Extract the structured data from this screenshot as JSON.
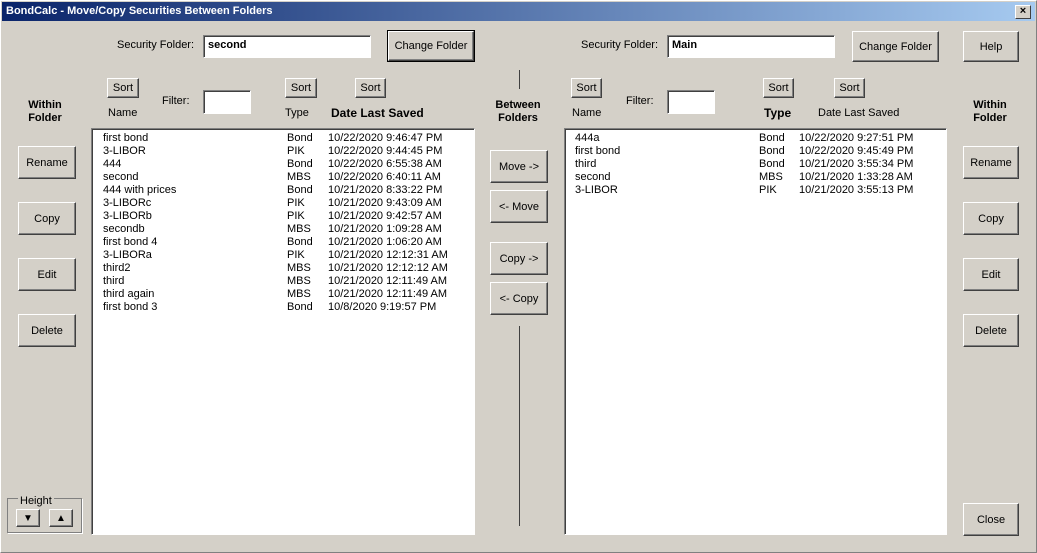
{
  "window": {
    "title": "BondCalc - Move/Copy Securities Between Folders",
    "close_label": "×"
  },
  "left": {
    "folder_label": "Security Folder:",
    "folder_value": "second",
    "change_folder": "Change Folder",
    "sort": "Sort",
    "name_header": "Name",
    "filter_label": "Filter:",
    "filter_value": "",
    "type_header": "Type",
    "date_header": "Date Last Saved",
    "rows": [
      {
        "name": "first bond",
        "type": "Bond",
        "date": "10/22/2020 9:46:47 PM"
      },
      {
        "name": "3-LIBOR",
        "type": "PIK",
        "date": "10/22/2020 9:44:45 PM"
      },
      {
        "name": "444",
        "type": "Bond",
        "date": "10/22/2020 6:55:38 AM"
      },
      {
        "name": "second",
        "type": "MBS",
        "date": "10/22/2020 6:40:11 AM"
      },
      {
        "name": "444 with prices",
        "type": "Bond",
        "date": "10/21/2020 8:33:22 PM"
      },
      {
        "name": "3-LIBORc",
        "type": "PIK",
        "date": "10/21/2020 9:43:09 AM"
      },
      {
        "name": "3-LIBORb",
        "type": "PIK",
        "date": "10/21/2020 9:42:57 AM"
      },
      {
        "name": "secondb",
        "type": "MBS",
        "date": "10/21/2020 1:09:28 AM"
      },
      {
        "name": "first bond 4",
        "type": "Bond",
        "date": "10/21/2020 1:06:20 AM"
      },
      {
        "name": "3-LIBORa",
        "type": "PIK",
        "date": "10/21/2020 12:12:31 AM"
      },
      {
        "name": "third2",
        "type": "MBS",
        "date": "10/21/2020 12:12:12 AM"
      },
      {
        "name": "third",
        "type": "MBS",
        "date": "10/21/2020 12:11:49 AM"
      },
      {
        "name": "third again",
        "type": "MBS",
        "date": "10/21/2020 12:11:49 AM"
      },
      {
        "name": "first bond 3",
        "type": "Bond",
        "date": "10/8/2020 9:19:57 PM"
      }
    ]
  },
  "right": {
    "folder_label": "Security Folder:",
    "folder_value": "Main",
    "change_folder": "Change Folder",
    "sort": "Sort",
    "name_header": "Name",
    "filter_label": "Filter:",
    "filter_value": "",
    "type_header": "Type",
    "date_header": "Date Last Saved",
    "rows": [
      {
        "name": "444a",
        "type": "Bond",
        "date": "10/22/2020 9:27:51 PM"
      },
      {
        "name": "first bond",
        "type": "Bond",
        "date": "10/22/2020 9:45:49 PM"
      },
      {
        "name": "third",
        "type": "Bond",
        "date": "10/21/2020 3:55:34 PM"
      },
      {
        "name": "second",
        "type": "MBS",
        "date": "10/21/2020 1:33:28 AM"
      },
      {
        "name": "3-LIBOR",
        "type": "PIK",
        "date": "10/21/2020 3:55:13 PM"
      }
    ]
  },
  "within": {
    "label_line1": "Within",
    "label_line2": "Folder",
    "rename": "Rename",
    "copy": "Copy",
    "edit": "Edit",
    "delete": "Delete"
  },
  "between": {
    "label_line1": "Between",
    "label_line2": "Folders",
    "move_right": "Move ->",
    "move_left": "<- Move",
    "copy_right": "Copy ->",
    "copy_left": "<- Copy"
  },
  "help": "Help",
  "close": "Close",
  "height": {
    "label": "Height",
    "down": "▼",
    "up": "▲"
  }
}
